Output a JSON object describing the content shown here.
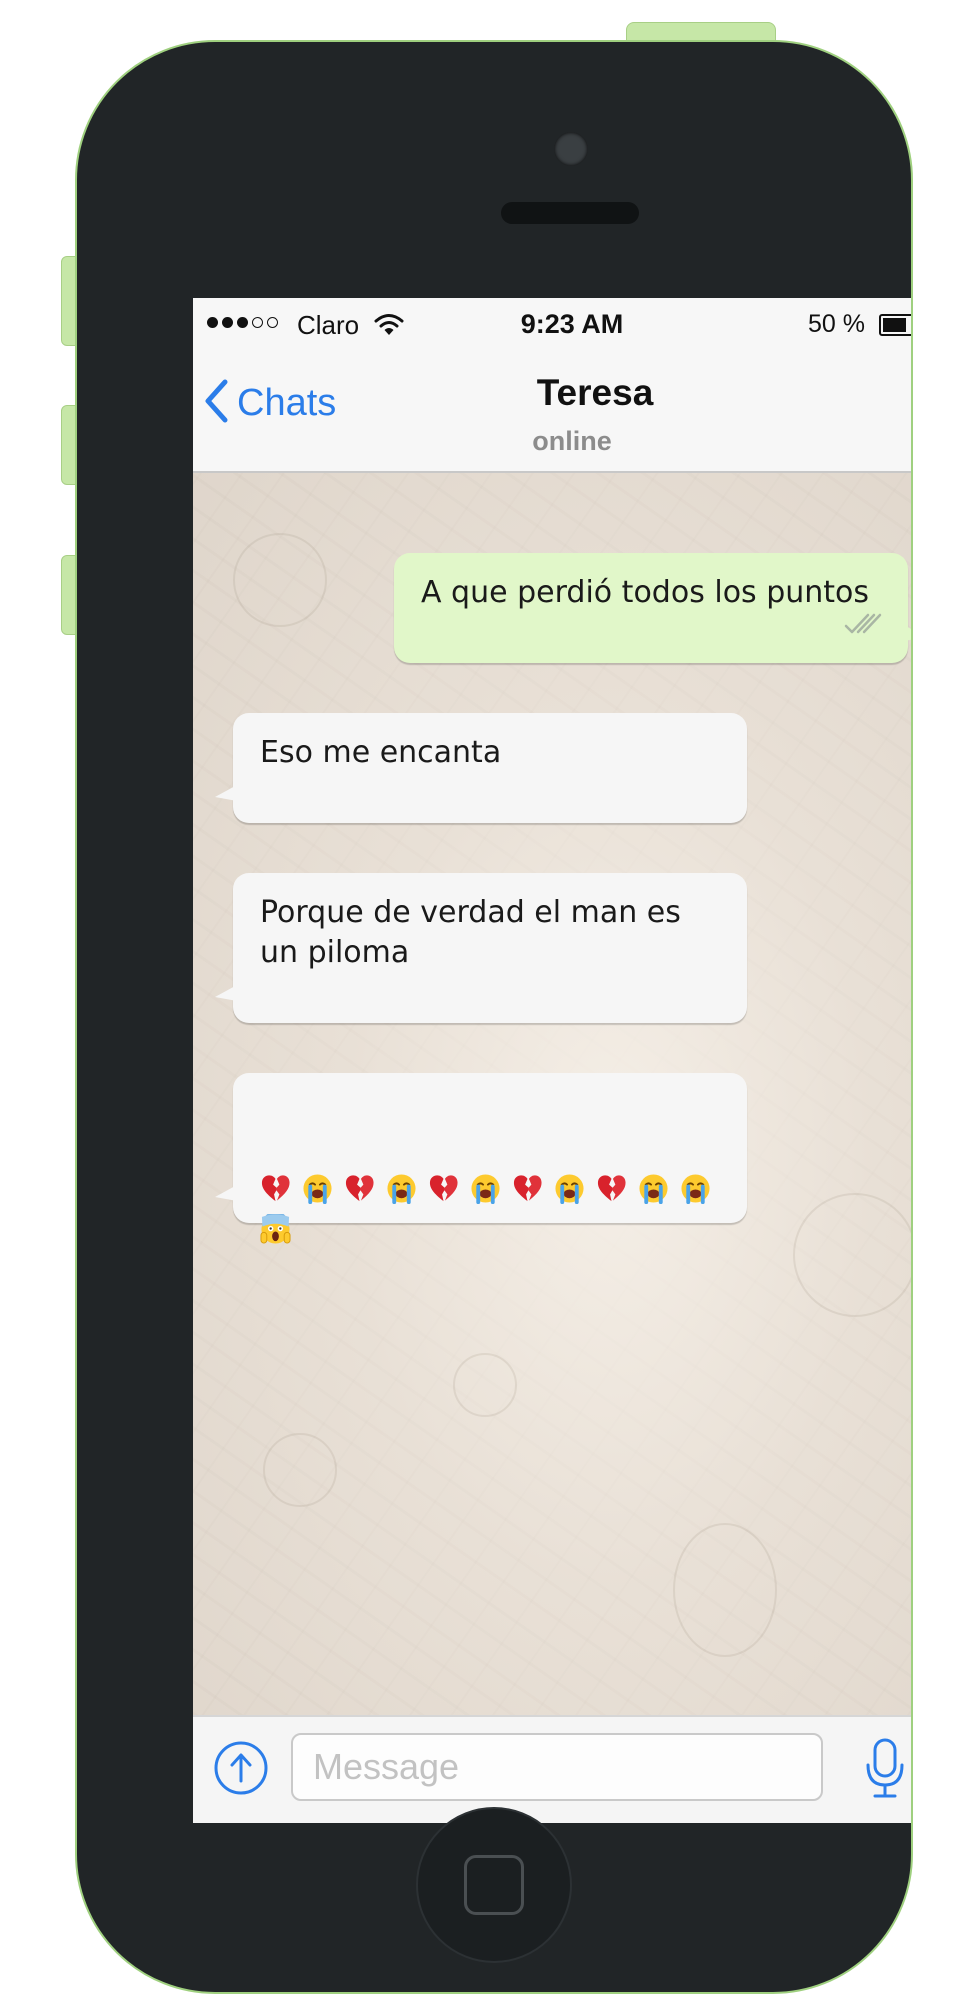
{
  "status_bar": {
    "carrier": "Claro",
    "time": "9:23 AM",
    "battery_percent": "50 %",
    "battery_level": 0.5,
    "signal_bars_filled": 3,
    "signal_bars_total": 5
  },
  "nav": {
    "back_label": "Chats",
    "contact_name": "Teresa",
    "contact_status": "online"
  },
  "messages": [
    {
      "direction": "outgoing",
      "text": "A que perdió todos los puntos",
      "read": true
    },
    {
      "direction": "incoming",
      "text": "Eso me encanta"
    },
    {
      "direction": "incoming",
      "text": "Porque de verdad el man es\nun piloma"
    },
    {
      "direction": "incoming",
      "emojis": [
        "broken-heart",
        "loudly-crying-face",
        "broken-heart",
        "loudly-crying-face",
        "broken-heart",
        "loudly-crying-face",
        "broken-heart",
        "loudly-crying-face",
        "broken-heart",
        "loudly-crying-face",
        "loudly-crying-face",
        "face-screaming-in-fear"
      ]
    }
  ],
  "composer": {
    "placeholder": "Message",
    "value": ""
  },
  "colors": {
    "accent": "#2b7de9",
    "outgoing_bubble": "#e1f7c9",
    "incoming_bubble": "#f6f6f6",
    "phone_body": "#212527",
    "phone_trim": "#c6e7a7"
  },
  "icons": {
    "back": "chevron-left-icon",
    "wifi": "wifi-icon",
    "battery": "battery-icon",
    "read_receipt": "double-check-icon",
    "attach": "upload-arrow-icon",
    "mic": "microphone-icon",
    "home": "home-button-icon"
  }
}
